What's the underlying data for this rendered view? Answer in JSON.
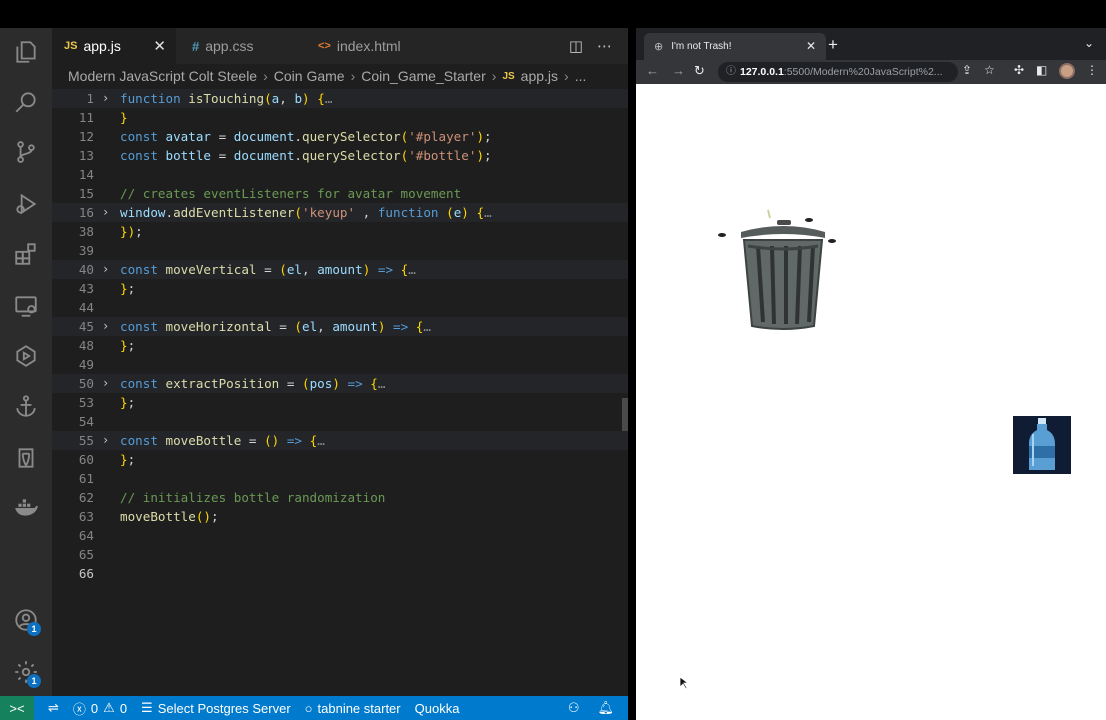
{
  "editor": {
    "tabs": [
      {
        "icon": "JS",
        "label": "app.js"
      },
      {
        "icon": "#",
        "label": "app.css"
      },
      {
        "icon": "<>",
        "label": "index.html"
      }
    ],
    "breadcrumb": [
      "Modern JavaScript Colt Steele",
      "Coin Game",
      "Coin_Game_Starter",
      "app.js",
      "..."
    ],
    "breadcrumb_file_icon": "JS",
    "lines": [
      {
        "n": "1",
        "folded": true,
        "code": [
          [
            "kw",
            "function "
          ],
          [
            "fn",
            "isTouching"
          ],
          [
            "br",
            "("
          ],
          [
            "var",
            "a"
          ],
          [
            "",
            ","
          ],
          [
            "var",
            " b"
          ],
          [
            "br",
            ")"
          ],
          [
            "",
            " "
          ],
          [
            "br",
            "{"
          ],
          [
            "dots",
            "…"
          ]
        ]
      },
      {
        "n": "11",
        "code": [
          [
            "br",
            "}"
          ]
        ]
      },
      {
        "n": "12",
        "code": [
          [
            "kw",
            "const "
          ],
          [
            "var",
            "avatar"
          ],
          [
            "",
            " = "
          ],
          [
            "var",
            "document"
          ],
          [
            "",
            "."
          ],
          [
            "fn",
            "querySelector"
          ],
          [
            "br",
            "("
          ],
          [
            "str",
            "'#player'"
          ],
          [
            "br",
            ")"
          ],
          [
            "",
            ";"
          ]
        ]
      },
      {
        "n": "13",
        "code": [
          [
            "kw",
            "const "
          ],
          [
            "var",
            "bottle"
          ],
          [
            "",
            " = "
          ],
          [
            "var",
            "document"
          ],
          [
            "",
            "."
          ],
          [
            "fn",
            "querySelector"
          ],
          [
            "br",
            "("
          ],
          [
            "str",
            "'#bottle'"
          ],
          [
            "br",
            ")"
          ],
          [
            "",
            ";"
          ]
        ]
      },
      {
        "n": "14",
        "code": []
      },
      {
        "n": "15",
        "code": [
          [
            "cm",
            "// creates eventListeners for avatar movement"
          ]
        ]
      },
      {
        "n": "16",
        "folded": true,
        "code": [
          [
            "var",
            "window"
          ],
          [
            "",
            "."
          ],
          [
            "fn",
            "addEventListener"
          ],
          [
            "br",
            "("
          ],
          [
            "str",
            "'keyup'"
          ],
          [
            "",
            " , "
          ],
          [
            "kw",
            "function "
          ],
          [
            "br",
            "("
          ],
          [
            "var",
            "e"
          ],
          [
            "br",
            ")"
          ],
          [
            "",
            " "
          ],
          [
            "br",
            "{"
          ],
          [
            "dots",
            "…"
          ]
        ]
      },
      {
        "n": "38",
        "code": [
          [
            "br",
            "})"
          ],
          [
            "",
            ";"
          ]
        ]
      },
      {
        "n": "39",
        "code": []
      },
      {
        "n": "40",
        "folded": true,
        "code": [
          [
            "kw",
            "const "
          ],
          [
            "fn",
            "moveVertical"
          ],
          [
            "",
            " = "
          ],
          [
            "br",
            "("
          ],
          [
            "var",
            "el"
          ],
          [
            "",
            ", "
          ],
          [
            "var",
            "amount"
          ],
          [
            "br",
            ")"
          ],
          [
            "",
            " "
          ],
          [
            "kw",
            "=>"
          ],
          [
            "",
            " "
          ],
          [
            "br",
            "{"
          ],
          [
            "dots",
            "…"
          ]
        ]
      },
      {
        "n": "43",
        "code": [
          [
            "br",
            "}"
          ],
          [
            "",
            ";"
          ]
        ]
      },
      {
        "n": "44",
        "code": []
      },
      {
        "n": "45",
        "folded": true,
        "code": [
          [
            "kw",
            "const "
          ],
          [
            "fn",
            "moveHorizontal"
          ],
          [
            "",
            " = "
          ],
          [
            "br",
            "("
          ],
          [
            "var",
            "el"
          ],
          [
            "",
            ", "
          ],
          [
            "var",
            "amount"
          ],
          [
            "br",
            ")"
          ],
          [
            "",
            " "
          ],
          [
            "kw",
            "=>"
          ],
          [
            "",
            " "
          ],
          [
            "br",
            "{"
          ],
          [
            "dots",
            "…"
          ]
        ]
      },
      {
        "n": "48",
        "code": [
          [
            "br",
            "}"
          ],
          [
            "",
            ";"
          ]
        ]
      },
      {
        "n": "49",
        "code": []
      },
      {
        "n": "50",
        "folded": true,
        "code": [
          [
            "kw",
            "const "
          ],
          [
            "fn",
            "extractPosition"
          ],
          [
            "",
            " = "
          ],
          [
            "br",
            "("
          ],
          [
            "var",
            "pos"
          ],
          [
            "br",
            ")"
          ],
          [
            "",
            " "
          ],
          [
            "kw",
            "=>"
          ],
          [
            "",
            " "
          ],
          [
            "br",
            "{"
          ],
          [
            "dots",
            "…"
          ]
        ]
      },
      {
        "n": "53",
        "code": [
          [
            "br",
            "}"
          ],
          [
            "",
            ";"
          ]
        ]
      },
      {
        "n": "54",
        "code": []
      },
      {
        "n": "55",
        "folded": true,
        "code": [
          [
            "kw",
            "const "
          ],
          [
            "fn",
            "moveBottle"
          ],
          [
            "",
            " = "
          ],
          [
            "br",
            "()"
          ],
          [
            "",
            " "
          ],
          [
            "kw",
            "=>"
          ],
          [
            "",
            " "
          ],
          [
            "br",
            "{"
          ],
          [
            "dots",
            "…"
          ]
        ]
      },
      {
        "n": "60",
        "code": [
          [
            "br",
            "}"
          ],
          [
            "",
            ";"
          ]
        ]
      },
      {
        "n": "61",
        "code": []
      },
      {
        "n": "62",
        "code": [
          [
            "cm",
            "// initializes bottle randomization"
          ]
        ]
      },
      {
        "n": "63",
        "code": [
          [
            "fn",
            "moveBottle"
          ],
          [
            "br",
            "()"
          ],
          [
            "",
            ";"
          ]
        ]
      },
      {
        "n": "64",
        "code": []
      },
      {
        "n": "65",
        "code": []
      },
      {
        "n": "66",
        "current": true,
        "code": []
      }
    ]
  },
  "activity_bar": {
    "icons": [
      "files-icon",
      "search-icon",
      "source-control-icon",
      "run-debug-icon",
      "extensions-icon",
      "remote-explorer-icon",
      "quokka-icon",
      "anchor-icon",
      "database-icon",
      "docker-icon"
    ],
    "account_badge": "1",
    "settings_badge": "1"
  },
  "statusbar": {
    "remote_icon": "><",
    "sync_icon": "⇌",
    "errors": "0",
    "warnings": "0",
    "postgres": "Select Postgres Server",
    "tabnine": "tabnine starter",
    "quokka": "Quokka"
  },
  "browser": {
    "tab_title": "I'm not Trash!",
    "url_host": "127.0.0.1",
    "url_rest": ":5500/Modern%20JavaScript%2...",
    "icons": [
      "back-icon",
      "forward-icon",
      "reload-icon",
      "share-icon",
      "star-icon",
      "extensions-icon",
      "sidebar-icon",
      "profile-avatar",
      "menu-icon"
    ]
  },
  "colors": {
    "editor_bg": "#1e1e1e",
    "statusbar_bg": "#007acc",
    "remote_bg": "#16825d",
    "badge_bg": "#0e70c0",
    "bottle_bg": "#0f1c33"
  }
}
